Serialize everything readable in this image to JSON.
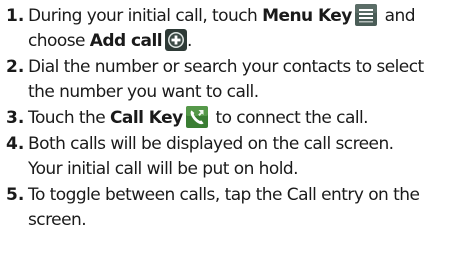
{
  "steps": [
    {
      "number": "1.",
      "line1_before": "During your initial call, touch ",
      "line1_bold": "Menu Key",
      "line1_after": " and",
      "line2_before": "choose ",
      "line2_bold": "Add call",
      "line2_after": "."
    },
    {
      "number": "2.",
      "line1": "Dial the number or search your contacts to select",
      "line2": "the number you want to call."
    },
    {
      "number": "3.",
      "line1_before": "Touch the ",
      "line1_bold": "Call Key",
      "line1_after": " to connect the call."
    },
    {
      "number": "4.",
      "line1": "Both calls will be displayed on the call screen.",
      "line2": "Your initial call will be put on hold."
    },
    {
      "number": "5.",
      "line1": "To toggle between calls, tap the Call entry on the",
      "line2": "screen."
    }
  ],
  "icons": {
    "menu_key": "menu-key-icon",
    "add_call": "add-call-icon",
    "call_key": "call-key-icon"
  },
  "colors": {
    "text": "#1a1a1a",
    "menu_key_bg": "#4a5d57",
    "add_call_bg": "#2e3a36",
    "call_key_bg": "#3a7d33"
  }
}
